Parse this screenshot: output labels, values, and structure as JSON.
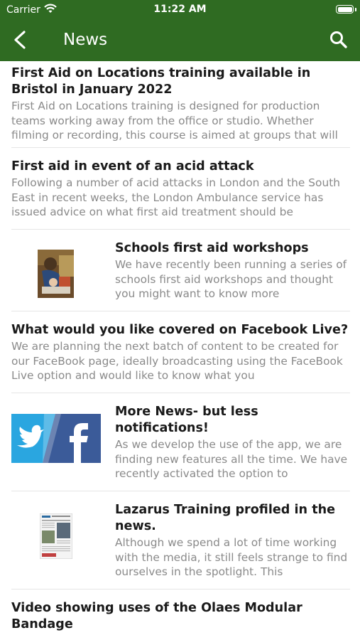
{
  "status": {
    "carrier": "Carrier",
    "time": "11:22 AM"
  },
  "nav": {
    "title": "News",
    "back_icon": "chevron-left-icon",
    "search_icon": "search-icon"
  },
  "colors": {
    "header": "#2f6b22",
    "title": "#1a1a1a",
    "body": "#8a8a8a",
    "divider": "#e5e5e5"
  },
  "items": [
    {
      "title": "First Aid on Locations training available in Bristol in January 2022",
      "body": "First Aid on Locations training is designed for production teams working away from the office or studio. Whether filming or recording, this course is aimed at groups that will"
    },
    {
      "title": "First aid in event of an acid attack",
      "body": "Following a number of acid attacks in London and the South East in recent weeks, the London Ambulance service has issued advice on what first aid treatment should be"
    },
    {
      "title": "Schools first aid workshops",
      "body": "We have recently been running a series of schools first aid workshops and thought you might want to know more",
      "thumb": "child-cpr-photo"
    },
    {
      "title": "What would you like covered on Facebook Live?",
      "body": "We are planning the next batch of content to be created for our FaceBook page, ideally broadcasting using the FaceBook Live option and would like to know what you"
    },
    {
      "title": "More News- but less notifications!",
      "body": "As we develop the use of the app, we are finding new features all the time. We have recently activated the option to",
      "thumb": "twitter-facebook-logos"
    },
    {
      "title": "Lazarus Training profiled in the news.",
      "body": "Although we spend a lot of time working with the media, it still feels strange to find ourselves in the spotlight. This",
      "thumb": "newspaper-clipping"
    },
    {
      "title": "Video showing uses of the Olaes Modular Bandage",
      "body": ""
    }
  ]
}
